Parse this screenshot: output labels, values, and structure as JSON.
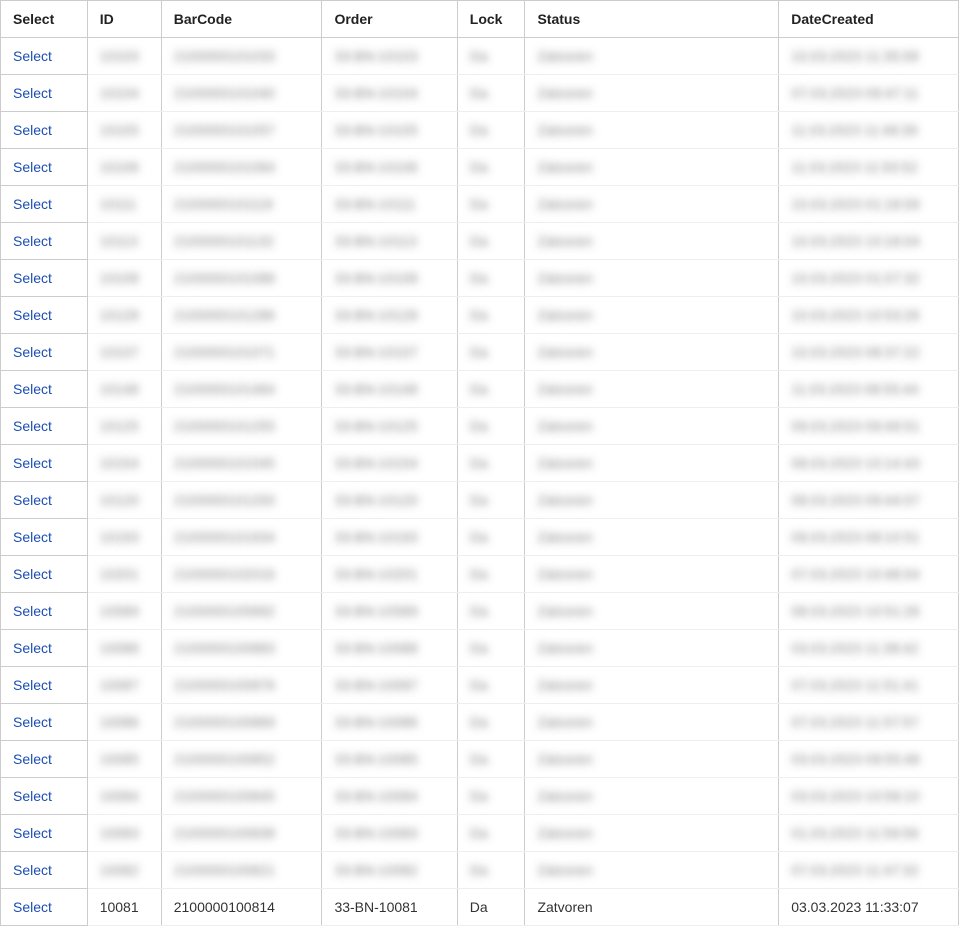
{
  "table": {
    "headers": {
      "select": "Select",
      "id": "ID",
      "barcode": "BarCode",
      "order": "Order",
      "lock": "Lock",
      "status": "Status",
      "dateCreated": "DateCreated"
    },
    "selectLabel": "Select",
    "rows": [
      {
        "id": "10103",
        "barcode": "2100000101033",
        "order": "33-BN-10103",
        "lock": "Da",
        "status": "Zatvoren",
        "dateCreated": "10.03.2023 11:35:08"
      },
      {
        "id": "10104",
        "barcode": "2100000101040",
        "order": "33-BN-10104",
        "lock": "Da",
        "status": "Zatvoren",
        "dateCreated": "07.03.2023 09:47:11"
      },
      {
        "id": "10105",
        "barcode": "2100000101057",
        "order": "33-BN-10105",
        "lock": "Da",
        "status": "Zatvoren",
        "dateCreated": "11.03.2023 11:48:39"
      },
      {
        "id": "10106",
        "barcode": "2100000101064",
        "order": "33-BN-10106",
        "lock": "Da",
        "status": "Zatvoren",
        "dateCreated": "11.03.2023 11:50:52"
      },
      {
        "id": "10111",
        "barcode": "2100000101118",
        "order": "33-BN-10111",
        "lock": "Da",
        "status": "Zatvoren",
        "dateCreated": "10.03.2023 01:18:09"
      },
      {
        "id": "10113",
        "barcode": "2100000101132",
        "order": "33-BN-10113",
        "lock": "Da",
        "status": "Zatvoren",
        "dateCreated": "10.03.2023 10:18:04"
      },
      {
        "id": "10108",
        "barcode": "2100000101088",
        "order": "33-BN-10108",
        "lock": "Da",
        "status": "Zatvoren",
        "dateCreated": "10.03.2023 01:07:32"
      },
      {
        "id": "10128",
        "barcode": "2100000101286",
        "order": "33-BN-10128",
        "lock": "Da",
        "status": "Zatvoren",
        "dateCreated": "10.03.2023 10:53:26"
      },
      {
        "id": "10107",
        "barcode": "2100000101071",
        "order": "33-BN-10107",
        "lock": "Da",
        "status": "Zatvoren",
        "dateCreated": "10.03.2023 08:37:22"
      },
      {
        "id": "10148",
        "barcode": "2100000101484",
        "order": "33-BN-10148",
        "lock": "Da",
        "status": "Zatvoren",
        "dateCreated": "11.03.2023 08:55:44"
      },
      {
        "id": "10125",
        "barcode": "2100000101255",
        "order": "33-BN-10125",
        "lock": "Da",
        "status": "Zatvoren",
        "dateCreated": "09.03.2023 09:49:51"
      },
      {
        "id": "10154",
        "barcode": "2100000101545",
        "order": "33-BN-10154",
        "lock": "Da",
        "status": "Zatvoren",
        "dateCreated": "08.03.2023 10:14:43"
      },
      {
        "id": "10120",
        "barcode": "2100000101200",
        "order": "33-BN-10120",
        "lock": "Da",
        "status": "Zatvoren",
        "dateCreated": "08.03.2023 09:44:07"
      },
      {
        "id": "10193",
        "barcode": "2100000101934",
        "order": "33-BN-10193",
        "lock": "Da",
        "status": "Zatvoren",
        "dateCreated": "09.03.2023 08:10:51"
      },
      {
        "id": "10201",
        "barcode": "2100000102016",
        "order": "33-BN-10201",
        "lock": "Da",
        "status": "Zatvoren",
        "dateCreated": "07.03.2023 10:48:04"
      },
      {
        "id": "10589",
        "barcode": "2100000105892",
        "order": "33-BN-10589",
        "lock": "Da",
        "status": "Zatvoren",
        "dateCreated": "08.03.2023 10:51:26"
      },
      {
        "id": "10088",
        "barcode": "2100000100883",
        "order": "33-BN-10088",
        "lock": "Da",
        "status": "Zatvoren",
        "dateCreated": "03.03.2023 11:38:42"
      },
      {
        "id": "10087",
        "barcode": "2100000100876",
        "order": "33-BN-10087",
        "lock": "Da",
        "status": "Zatvoren",
        "dateCreated": "07.03.2023 11:51:41"
      },
      {
        "id": "10086",
        "barcode": "2100000100869",
        "order": "33-BN-10086",
        "lock": "Da",
        "status": "Zatvoren",
        "dateCreated": "07.03.2023 11:57:57"
      },
      {
        "id": "10085",
        "barcode": "2100000100852",
        "order": "33-BN-10085",
        "lock": "Da",
        "status": "Zatvoren",
        "dateCreated": "03.03.2023 09:55:48"
      },
      {
        "id": "10084",
        "barcode": "2100000100845",
        "order": "33-BN-10084",
        "lock": "Da",
        "status": "Zatvoren",
        "dateCreated": "03.03.2023 10:58:10"
      },
      {
        "id": "10083",
        "barcode": "2100000100838",
        "order": "33-BN-10083",
        "lock": "Da",
        "status": "Zatvoren",
        "dateCreated": "01.03.2023 11:59:56"
      },
      {
        "id": "10082",
        "barcode": "2100000100821",
        "order": "33-BN-10082",
        "lock": "Da",
        "status": "Zatvoren",
        "dateCreated": "07.03.2023 11:47:32"
      },
      {
        "id": "10081",
        "barcode": "2100000100814",
        "order": "33-BN-10081",
        "lock": "Da",
        "status": "Zatvoren",
        "dateCreated": "03.03.2023 11:33:07"
      }
    ]
  }
}
